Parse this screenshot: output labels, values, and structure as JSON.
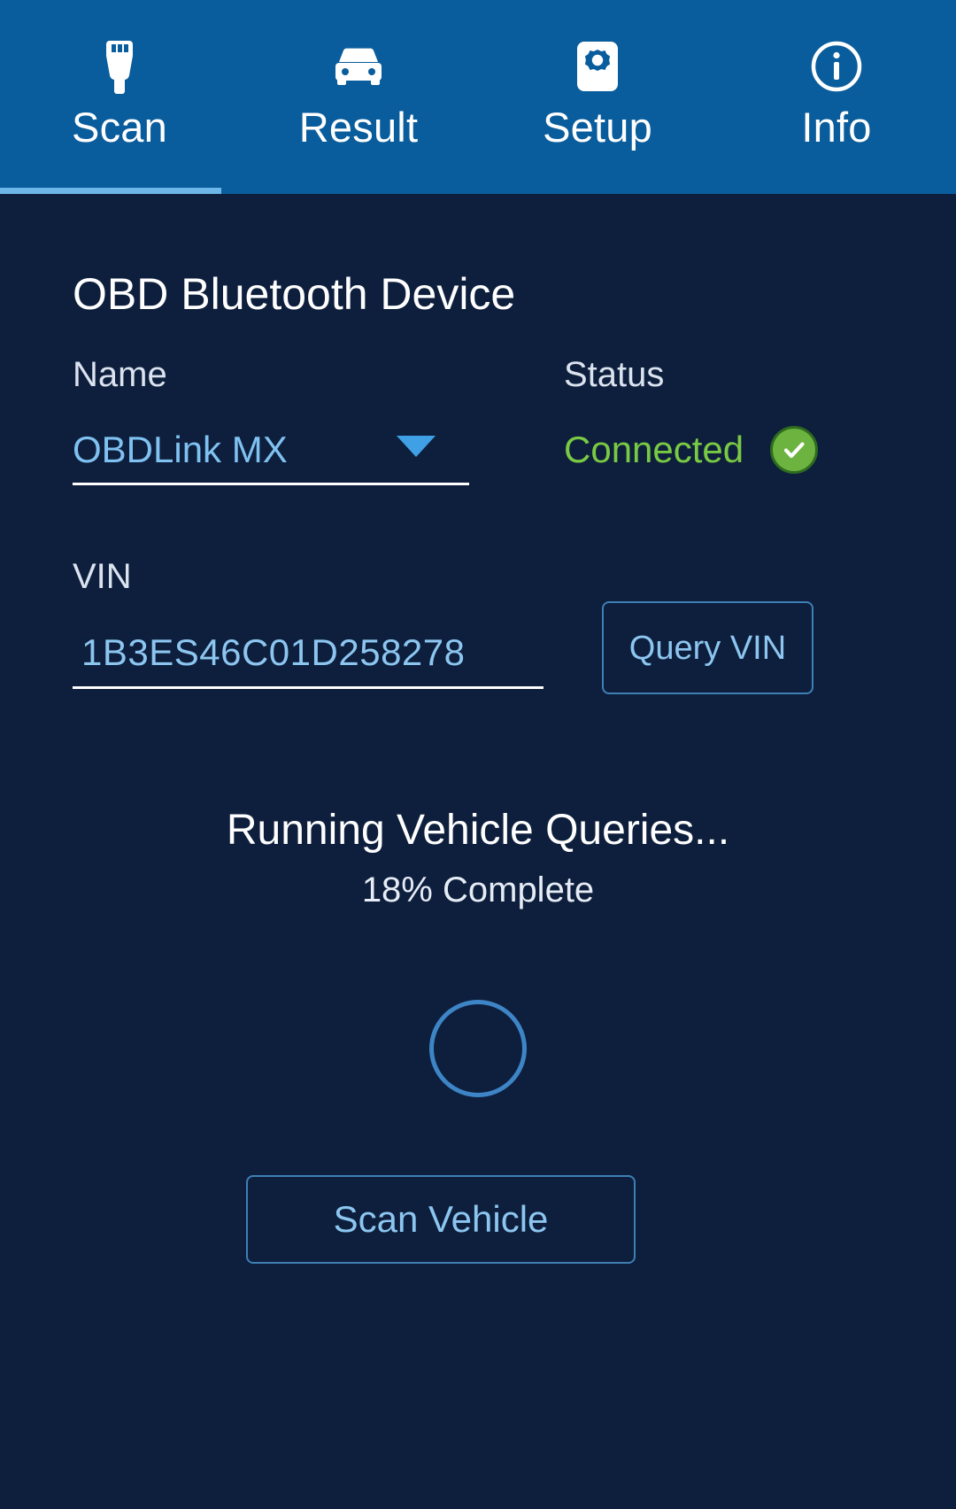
{
  "app": {
    "accent_blue": "#0a5d9c",
    "background": "#0e1f3d",
    "active_underline": "#6cb6e8",
    "link_blue": "#8cc6f0",
    "status_green": "#7ac943"
  },
  "tabs": [
    {
      "label": "Scan",
      "icon": "obd-connector-icon",
      "active": true
    },
    {
      "label": "Result",
      "icon": "car-icon",
      "active": false
    },
    {
      "label": "Setup",
      "icon": "gear-icon",
      "active": false
    },
    {
      "label": "Info",
      "icon": "info-circle-icon",
      "active": false
    }
  ],
  "device_section": {
    "title": "OBD Bluetooth Device",
    "name_label": "Name",
    "name_value": "OBDLink MX",
    "name_options": [
      "OBDLink MX"
    ],
    "status_label": "Status",
    "status_value": "Connected",
    "status_icon": "check-badge-icon"
  },
  "vin_section": {
    "label": "VIN",
    "value": "1B3ES46C01D258278",
    "placeholder": "VIN",
    "query_button": "Query VIN"
  },
  "progress": {
    "title": "Running Vehicle Queries...",
    "subtitle": "18% Complete",
    "percent": 18,
    "spinner": "loading-spinner-icon"
  },
  "actions": {
    "scan_vehicle": "Scan Vehicle"
  }
}
